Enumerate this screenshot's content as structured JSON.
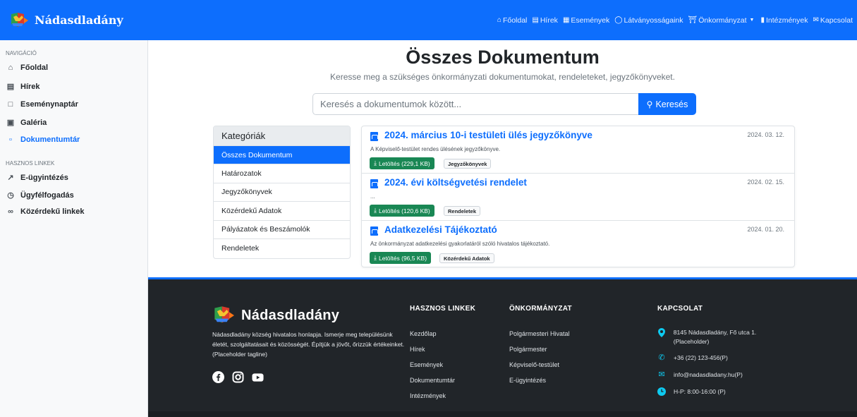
{
  "app": {
    "brand_name": "Nádasdladány",
    "accent": "#0d6efd"
  },
  "topnav": [
    {
      "icon": "home-icon",
      "label": "Főoldal"
    },
    {
      "icon": "news-icon",
      "label": "Hírek"
    },
    {
      "icon": "calendar-icon",
      "label": "Események"
    },
    {
      "icon": "camera-icon",
      "label": "Látványosságaink"
    },
    {
      "icon": "institution-icon",
      "label": "Önkormányzat"
    },
    {
      "icon": "bookmark-icon",
      "label": "Intézmények"
    },
    {
      "icon": "mail-icon",
      "label": "Kapcsolat"
    }
  ],
  "sidebar": {
    "nav_heading": "NAVIGÁCIÓ",
    "nav_items": [
      {
        "icon": "home-icon",
        "label": "Főoldal"
      },
      {
        "icon": "news-icon",
        "label": "Hírek"
      },
      {
        "icon": "calendar-icon",
        "label": "Eseménynaptár"
      },
      {
        "icon": "image-icon",
        "label": "Galéria"
      },
      {
        "icon": "document-icon",
        "label": "Dokumentumtár"
      }
    ],
    "links_heading": "HASZNOS LINKEK",
    "link_items": [
      {
        "icon": "external-link-icon",
        "label": "E-ügyintézés"
      },
      {
        "icon": "clock-icon",
        "label": "Ügyfélfogadás"
      },
      {
        "icon": "link-icon",
        "label": "Közérdekű linkek"
      }
    ]
  },
  "main": {
    "title": "Összes Dokumentum",
    "subtitle": "Keresse meg a szükséges önkormányzati dokumentumokat, rendeleteket, jegyzőkönyveket.",
    "search_placeholder": "Keresés a dokumentumok között...",
    "search_button": "Keresés"
  },
  "categories": {
    "header": "Kategóriák",
    "items": [
      "Összes Dokumentum",
      "Határozatok",
      "Jegyzőkönyvek",
      "Közérdekű Adatok",
      "Pályázatok és Beszámolók",
      "Rendeletek"
    ]
  },
  "documents": [
    {
      "title": "2024. március 10-i testületi ülés jegyzőkönyve",
      "date": "2024. 03. 12.",
      "description": "A Képviselő-testület rendes ülésének jegyzőkönyve.",
      "download": "Letöltés (229,1 KB)",
      "tag": "Jegyzőkönyvek"
    },
    {
      "title": "2024. évi költségvetési rendelet",
      "date": "2024. 02. 15.",
      "description": "...",
      "download": "Letöltés (120,6 KB)",
      "tag": "Rendeletek"
    },
    {
      "title": "Adatkezelési Tájékoztató",
      "date": "2024. 01. 20.",
      "description": "Az önkormányzat adatkezelési gyakorlatáról szóló hivatalos tájékoztató.",
      "download": "Letöltés (96,5 KB)",
      "tag": "Közérdekű Adatok"
    }
  ],
  "footer": {
    "brand_name": "Nádasdladány",
    "tagline": "Nádasdladány község hivatalos honlapja. Ismerje meg településünk életét, szolgáltatásait és közösségét. Építjük a jövőt, őrizzük értékeinket. (Placeholder tagline)",
    "social": [
      "facebook-icon",
      "instagram-icon",
      "youtube-icon"
    ],
    "useful_heading": "HASZNOS LINKEK",
    "useful_links": [
      "Kezdőlap",
      "Hírek",
      "Események",
      "Dokumentumtár",
      "Intézmények"
    ],
    "gov_heading": "ÖNKORMÁNYZAT",
    "gov_links": [
      "Polgármesteri Hivatal",
      "Polgármester",
      "Képviselő-testület",
      "E-ügyintézés"
    ],
    "contact_heading": "KAPCSOLAT",
    "contact": [
      {
        "icon": "location-icon",
        "text": "8145 Nádasdladány, Fő utca 1. (Placeholder)"
      },
      {
        "icon": "phone-icon",
        "text": "+36 (22) 123-456(P)"
      },
      {
        "icon": "mail-icon",
        "text": "info@nadasdladany.hu(P)"
      },
      {
        "icon": "clock-icon",
        "text": "H-P: 8:00-16:00 (P)"
      }
    ]
  }
}
